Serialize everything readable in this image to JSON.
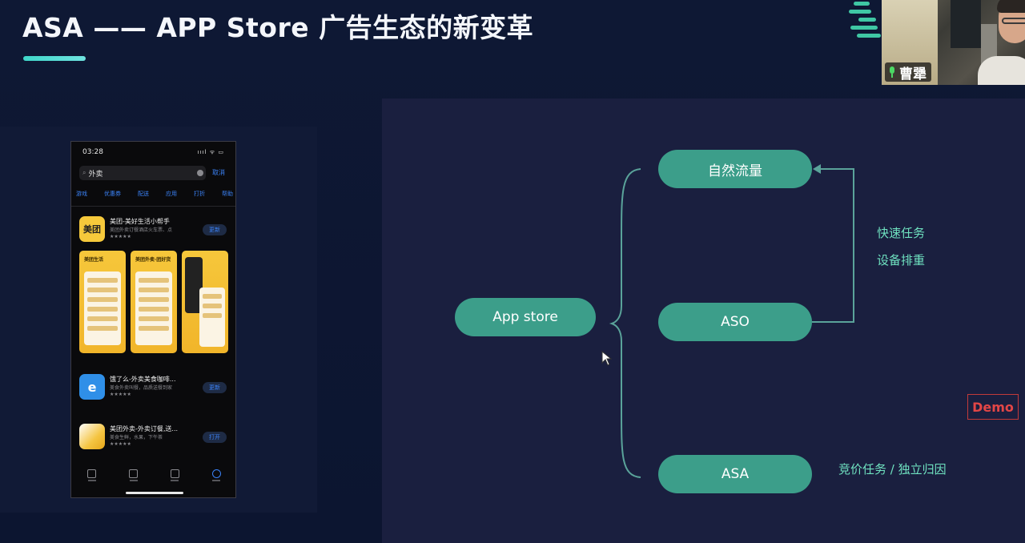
{
  "slide": {
    "title": "ASA —— APP Store 广告生态的新变革",
    "colors": {
      "accent": "#3fd6c9",
      "pill": "#3c9e8a",
      "note_text": "#6fe2c0",
      "demo_red": "#e34646"
    }
  },
  "video": {
    "name": "曹犟",
    "icon": "mic-icon"
  },
  "phone": {
    "time": "03:28",
    "status_right": "ıııl ᯤ ▭",
    "search_value": "外卖",
    "cancel_label": "取消",
    "filters": [
      "游戏",
      "优惠券",
      "配送",
      "应用",
      "打折",
      "帮助"
    ],
    "apps": [
      {
        "name": "美团-美好生活小帮手",
        "sub": "美团外卖订餐酒店火车票、点",
        "stars": "★★★★★",
        "button": "更新",
        "icon_text": "美团"
      },
      {
        "name": "饿了么-外卖美食咖啡...",
        "sub": "美食外卖叫餐，品质送餐到家",
        "stars": "★★★★★",
        "button": "更新",
        "icon_text": "e"
      },
      {
        "name": "美团外卖-外卖订餐,送...",
        "sub": "美食生鲜，水果，下午茶",
        "stars": "★★★★★",
        "button": "打开",
        "icon_text": ""
      }
    ],
    "shots": [
      "美团生活",
      "美团外卖·团好货",
      ""
    ]
  },
  "diagram": {
    "root": "App store",
    "nodes": [
      "自然流量",
      "ASO",
      "ASA"
    ],
    "notes": {
      "task1": "快速任务",
      "task2": "设备排重",
      "asa": "竞价任务 / 独立归因"
    },
    "demo": "Demo"
  }
}
